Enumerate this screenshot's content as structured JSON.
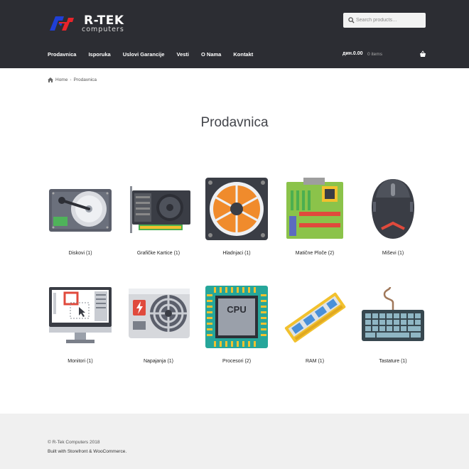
{
  "header": {
    "logo_text": "R-TEK",
    "logo_sub": "computers",
    "search_placeholder": "Search products…"
  },
  "nav": {
    "items": [
      "Prodavnica",
      "Isporuka",
      "Uslovi Garancije",
      "Vesti",
      "O Nama",
      "Kontakt"
    ]
  },
  "cart": {
    "amount": "дин.0.00",
    "items": "0 items"
  },
  "breadcrumb": {
    "home": "Home",
    "current": "Prodavnica"
  },
  "page": {
    "title": "Prodavnica"
  },
  "categories": [
    {
      "label": "Diskovi (1)",
      "icon": "hard-drive-icon"
    },
    {
      "label": "Grafičke Kartice (1)",
      "icon": "graphics-card-icon"
    },
    {
      "label": "Hladnjaci (1)",
      "icon": "cooling-fan-icon"
    },
    {
      "label": "Matične Ploče (2)",
      "icon": "motherboard-icon"
    },
    {
      "label": "Miševi (1)",
      "icon": "mouse-icon"
    },
    {
      "label": "Monitori (1)",
      "icon": "monitor-icon"
    },
    {
      "label": "Napajanja (1)",
      "icon": "power-supply-icon"
    },
    {
      "label": "Procesori (2)",
      "icon": "cpu-icon"
    },
    {
      "label": "RAM (1)",
      "icon": "ram-icon"
    },
    {
      "label": "Tastature (1)",
      "icon": "keyboard-icon"
    }
  ],
  "cpu_text": "CPU",
  "footer": {
    "copyright": "© R-Tek Computers 2018",
    "built": "Built with Storefront & WooCommerce."
  }
}
